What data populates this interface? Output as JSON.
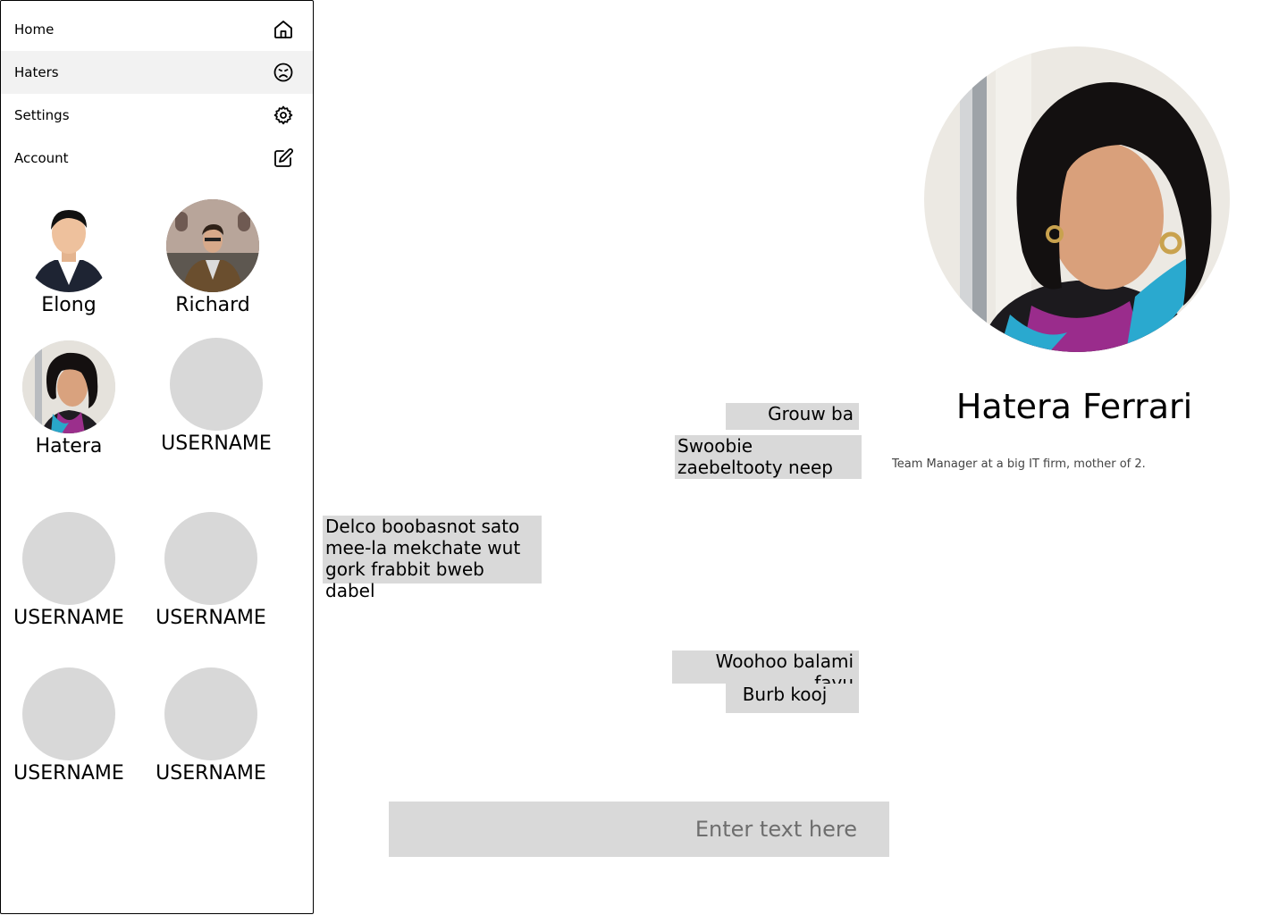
{
  "nav": {
    "items": [
      {
        "label": "Home",
        "icon": "home-icon"
      },
      {
        "label": "Haters",
        "icon": "frown-face-icon"
      },
      {
        "label": "Settings",
        "icon": "gear-icon"
      },
      {
        "label": "Account",
        "icon": "edit-icon"
      }
    ],
    "active": "Haters"
  },
  "haters": [
    {
      "name": "Elong",
      "photo": "person-photo"
    },
    {
      "name": "Richard",
      "photo": "person-photo"
    },
    {
      "name": "Hatera",
      "photo": "person-photo"
    },
    {
      "name": "USERNAME",
      "photo": "placeholder"
    },
    {
      "name": "USERNAME",
      "photo": "placeholder"
    },
    {
      "name": "USERNAME",
      "photo": "placeholder"
    },
    {
      "name": "USERNAME",
      "photo": "placeholder"
    },
    {
      "name": "USERNAME",
      "photo": "placeholder"
    }
  ],
  "chat": {
    "messages": [
      {
        "text": "Grouw ba",
        "direction": "outgoing"
      },
      {
        "text": "Swoobie zaebeltooty neep",
        "direction": "outgoing"
      },
      {
        "text": "Delco boobasnot sato mee-la mekchate wut gork frabbit bweb dabel",
        "direction": "incoming"
      },
      {
        "text": "Woohoo balami favu",
        "direction": "outgoing"
      },
      {
        "text": "Burb kooj",
        "direction": "outgoing"
      }
    ],
    "input_placeholder": "Enter text here"
  },
  "profile": {
    "name": "Hatera Ferrari",
    "bio": "Team Manager at a big IT firm, mother of 2."
  },
  "colors": {
    "placeholder_gray": "#d9d9d9",
    "active_nav_bg": "#f2f2f2",
    "bubble_bg": "#d9d9d9"
  }
}
